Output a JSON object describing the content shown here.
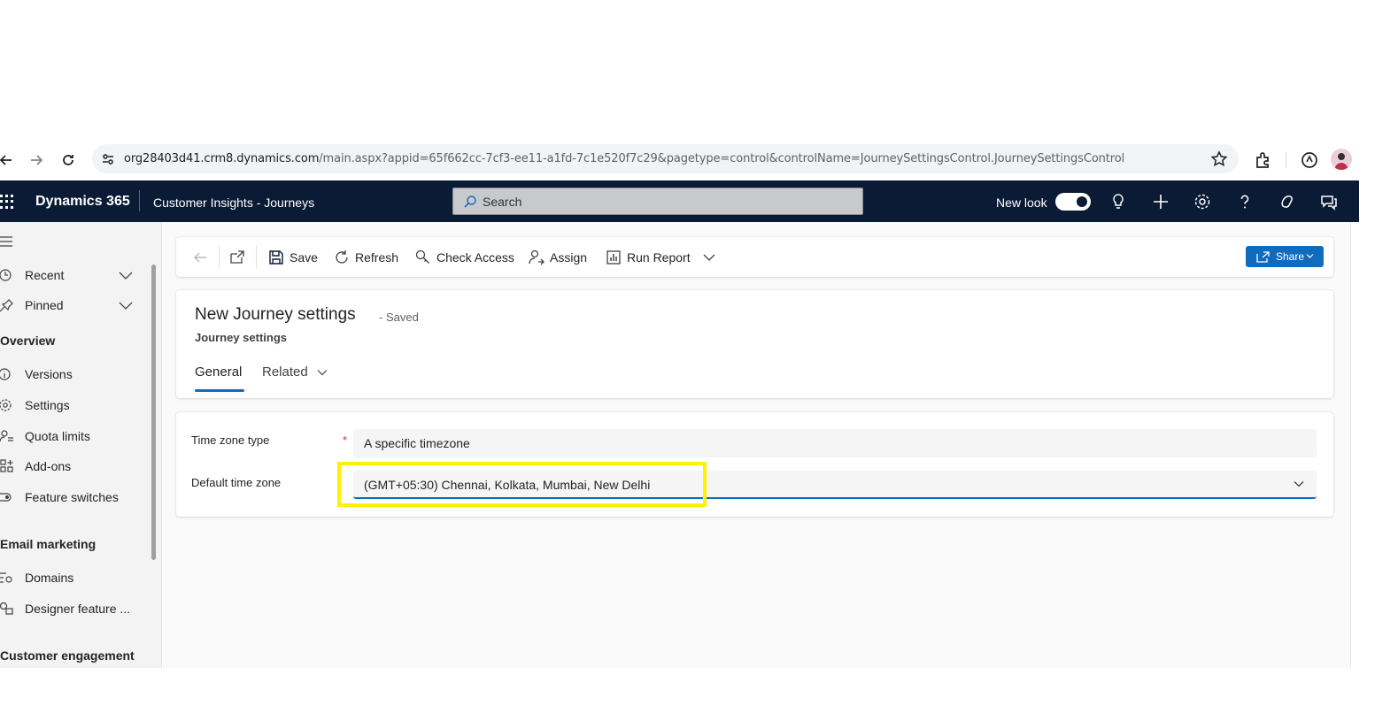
{
  "browser": {
    "url_host": "org28403d41.crm8.dynamics.com",
    "url_path": "/main.aspx?appid=65f662cc-7cf3-ee11-a1fd-7c1e520f7c29&pagetype=control&controlName=JourneySettingsControl.JourneySettingsControl"
  },
  "header": {
    "brand": "Dynamics 365",
    "app_name": "Customer Insights - Journeys",
    "search_placeholder": "Search",
    "new_look_label": "New look",
    "new_look_on": true
  },
  "sidebar": {
    "items_top": [
      {
        "label": "Recent",
        "icon": "clock-icon"
      },
      {
        "label": "Pinned",
        "icon": "pin-icon"
      }
    ],
    "groups": [
      {
        "title": "Overview",
        "items": [
          {
            "label": "Versions",
            "icon": "info-icon"
          },
          {
            "label": "Settings",
            "icon": "gear-icon"
          },
          {
            "label": "Quota limits",
            "icon": "person-list-icon"
          },
          {
            "label": "Add-ons",
            "icon": "grid-add-icon"
          },
          {
            "label": "Feature switches",
            "icon": "toggle-icon"
          }
        ]
      },
      {
        "title": "Email marketing",
        "items": [
          {
            "label": "Domains",
            "icon": "domain-icon"
          },
          {
            "label": "Designer feature ...",
            "icon": "shapes-icon"
          }
        ]
      },
      {
        "title": "Customer engagement",
        "items": []
      }
    ]
  },
  "commandbar": {
    "save": "Save",
    "refresh": "Refresh",
    "check_access": "Check Access",
    "assign": "Assign",
    "run_report": "Run Report",
    "share": "Share"
  },
  "record": {
    "title": "New Journey settings",
    "status": "- Saved",
    "entity": "Journey settings",
    "tabs": [
      {
        "label": "General",
        "active": true
      },
      {
        "label": "Related",
        "active": false
      }
    ]
  },
  "form": {
    "timezone_type": {
      "label": "Time zone type",
      "value": "A specific timezone",
      "required": "*"
    },
    "default_timezone": {
      "label": "Default time zone",
      "value": "(GMT+05:30) Chennai, Kolkata, Mumbai, New Delhi"
    }
  },
  "colors": {
    "header_bg": "#0b1b35",
    "accent": "#0f6cbd",
    "highlight": "#fff200"
  }
}
